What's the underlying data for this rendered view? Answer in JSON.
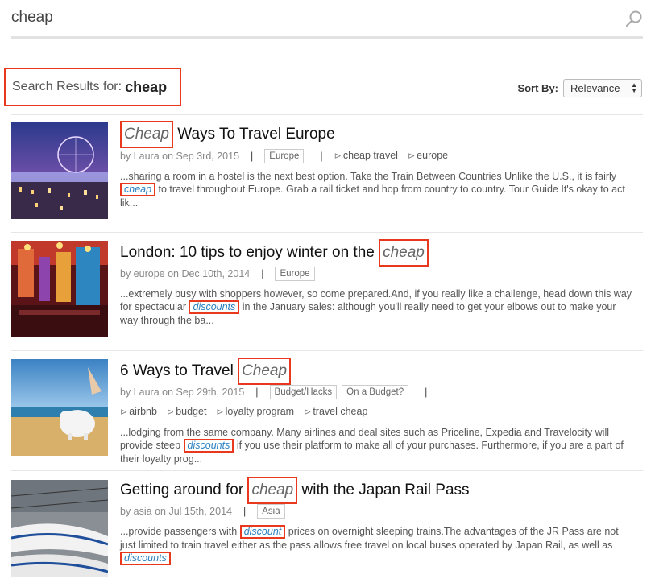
{
  "search": {
    "value": "cheap",
    "icon": "search-icon"
  },
  "header": {
    "label": "Search Results for:",
    "query": "cheap"
  },
  "sort": {
    "label": "Sort By:",
    "selected": "Relevance"
  },
  "results": [
    {
      "title_pre": "",
      "title_hl": "Cheap",
      "title_post": " Ways To Travel Europe",
      "meta": "by Laura on Sep 3rd, 2015",
      "categories": [
        "Europe"
      ],
      "tags": [
        "cheap travel",
        "europe"
      ],
      "ex1": "...sharing a room in a hostel is the next best option.    Take the Train Between Countries Unlike the U.S., it is fairly ",
      "ex_hl": "cheap",
      "ex2": " to travel throughout Europe. Grab a rail ticket and hop from country to country.   Tour Guide  It's okay to act lik..."
    },
    {
      "title_pre": "London: 10 tips to enjoy winter on the ",
      "title_hl": "cheap",
      "title_post": "",
      "meta": "by europe on Dec 10th, 2014",
      "categories": [
        "Europe"
      ],
      "tags": [],
      "ex1": "...extremely busy with shoppers however, so come prepared.And, if you really like a challenge, head down this way for spectacular ",
      "ex_hl": "discounts",
      "ex2": " in the January sales: although you'll really need to get your elbows out to make your way through the ba..."
    },
    {
      "title_pre": "6 Ways to Travel ",
      "title_hl": "Cheap",
      "title_post": "",
      "meta": "by Laura on Sep 29th, 2015",
      "categories": [
        "Budget/Hacks",
        "On a Budget?"
      ],
      "tags": [
        "airbnb",
        "budget",
        "loyalty program",
        "travel cheap"
      ],
      "ex1": "...lodging from the same company. Many airlines and deal sites such as Priceline, Expedia and Travelocity will provide steep ",
      "ex_hl": "discounts",
      "ex2": " if you use their platform to make all of your purchases. Furthermore, if you are a part of their loyalty prog..."
    },
    {
      "title_pre": "Getting around for ",
      "title_hl": "cheap",
      "title_post": " with the Japan Rail Pass",
      "meta": "by asia on Jul 15th, 2014",
      "categories": [
        "Asia"
      ],
      "tags": [],
      "ex1": "...provide passengers with ",
      "ex_hl": "discount",
      "ex2": " prices on overnight sleeping trains.The advantages of the JR Pass are not just limited to train travel either as the pass allows free travel on local buses operated by Japan Rail, as well as ",
      "ex_hl2": "discounts"
    }
  ],
  "colors": {
    "highlight_border": "#e8391f",
    "link_blue": "#2a7fbf"
  }
}
